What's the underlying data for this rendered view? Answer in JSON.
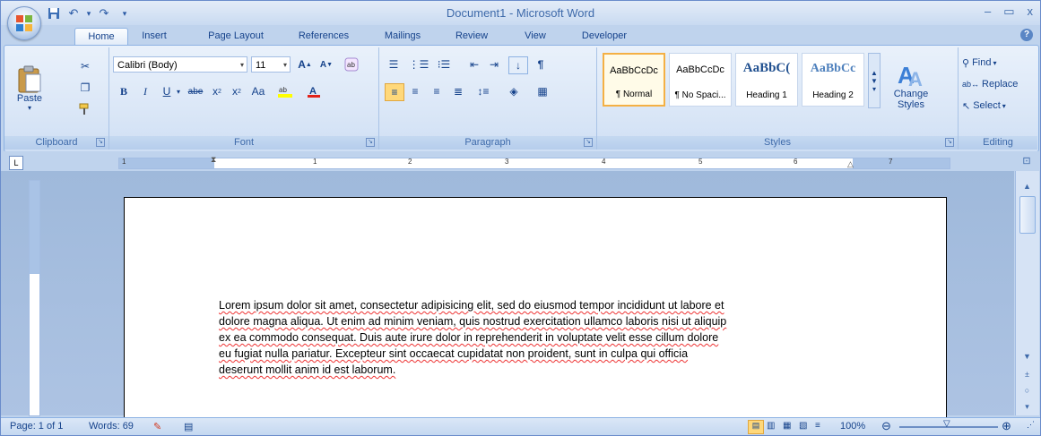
{
  "window": {
    "title": "Document1 - Microsoft Word",
    "minimize": "–",
    "maximize": "▭",
    "close": "x"
  },
  "qat": {
    "save": "▪",
    "undo": "↶",
    "redo": "↷",
    "customize": "▾"
  },
  "tabs": [
    {
      "label": "Home"
    },
    {
      "label": "Insert"
    },
    {
      "label": "Page Layout"
    },
    {
      "label": "References"
    },
    {
      "label": "Mailings"
    },
    {
      "label": "Review"
    },
    {
      "label": "View"
    },
    {
      "label": "Developer"
    }
  ],
  "help": "?",
  "ribbon": {
    "clipboard": {
      "label": "Clipboard",
      "paste": "Paste"
    },
    "font": {
      "label": "Font",
      "name": "Calibri (Body)",
      "size": "11"
    },
    "paragraph": {
      "label": "Paragraph"
    },
    "styles": {
      "label": "Styles",
      "items": [
        {
          "sample": "AaBbCcDc",
          "name": "¶ Normal"
        },
        {
          "sample": "AaBbCcDc",
          "name": "¶ No Spaci..."
        },
        {
          "sample": "AaBbC(",
          "name": "Heading 1"
        },
        {
          "sample": "AaBbCc",
          "name": "Heading 2"
        }
      ],
      "change_styles": "Change Styles"
    },
    "editing": {
      "label": "Editing",
      "find": "Find",
      "replace": "Replace",
      "select": "Select"
    }
  },
  "ruler": {
    "numbers": [
      "1",
      "1",
      "2",
      "3",
      "4",
      "5",
      "6",
      "7"
    ]
  },
  "document": {
    "lines": [
      "Lorem ipsum dolor sit amet, consectetur adipisicing elit, sed do eiusmod tempor incididunt ut labore et",
      "dolore magna aliqua. Ut enim ad minim veniam, quis nostrud exercitation ullamco laboris nisi ut aliquip",
      "ex ea commodo consequat. Duis aute irure dolor in reprehenderit in voluptate velit esse cillum dolore",
      "eu fugiat nulla pariatur. Excepteur sint occaecat cupidatat non proident, sunt in culpa qui officia",
      "deserunt mollit anim id est laborum."
    ]
  },
  "status": {
    "page": "Page: 1 of 1",
    "words": "Words: 69",
    "zoom": "100%"
  }
}
